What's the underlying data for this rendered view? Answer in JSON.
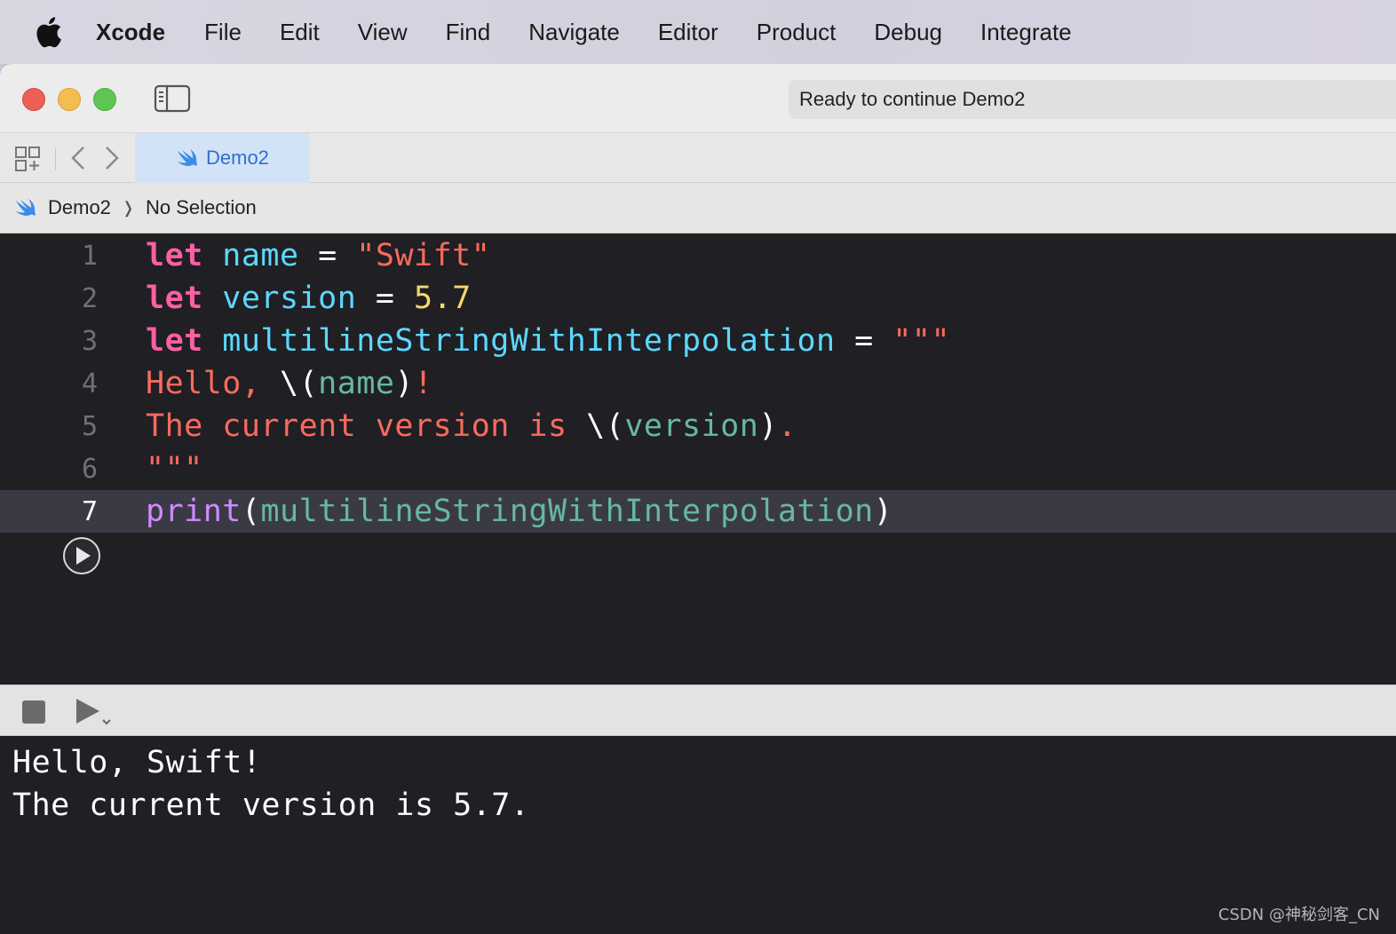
{
  "menubar": {
    "app_name": "Xcode",
    "items": [
      "File",
      "Edit",
      "View",
      "Find",
      "Navigate",
      "Editor",
      "Product",
      "Debug",
      "Integrate"
    ]
  },
  "toolbar": {
    "status": "Ready to continue Demo2"
  },
  "tabs": [
    {
      "label": "Demo2",
      "active": true
    }
  ],
  "breadcrumb": {
    "project": "Demo2",
    "selection": "No Selection"
  },
  "editor": {
    "current_line": 7,
    "lines": [
      {
        "number": "1"
      },
      {
        "number": "2"
      },
      {
        "number": "3"
      },
      {
        "number": "4"
      },
      {
        "number": "5"
      },
      {
        "number": "6"
      },
      {
        "number": "7"
      }
    ],
    "tokens": {
      "l1": [
        "let",
        " name",
        " = ",
        "\"Swift\""
      ],
      "l2": [
        "let",
        " version",
        " = ",
        "5.7"
      ],
      "l3": [
        "let",
        " multilineStringWithInterpolation",
        " = ",
        "\"\"\""
      ],
      "l4": [
        "Hello, ",
        "\\(",
        "name",
        ")",
        "!"
      ],
      "l5": [
        "The current version is ",
        "\\(",
        "version",
        ")",
        "."
      ],
      "l6": [
        "\"\"\""
      ],
      "l7": [
        "print",
        "(",
        "multilineStringWithInterpolation",
        ")"
      ]
    }
  },
  "console": {
    "output": [
      "Hello, Swift!",
      "The current version is 5.7."
    ]
  },
  "watermark": "CSDN @神秘剑客_CN",
  "colors": {
    "keyword": "#fc5fa3",
    "variable": "#5dd8ff",
    "string": "#fc6a5d",
    "number": "#f5d86d",
    "function": "#d08aff",
    "tab_accent": "#2f6fd0"
  },
  "icons": {
    "apple": "apple-logo-icon",
    "sidebar": "sidebar-toggle-icon",
    "grid": "related-items-grid-icon",
    "back": "chevron-left-icon",
    "forward": "chevron-right-icon",
    "swift": "swift-icon",
    "run": "play-circle-icon",
    "stop": "stop-icon",
    "execute": "play-icon"
  }
}
